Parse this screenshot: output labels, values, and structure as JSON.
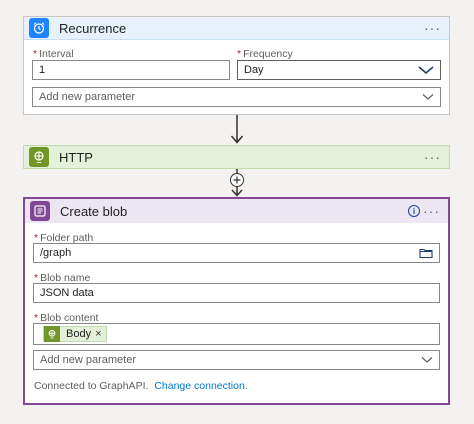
{
  "recurrence": {
    "title": "Recurrence",
    "more": "···",
    "interval_label": "Interval",
    "interval_value": "1",
    "frequency_label": "Frequency",
    "frequency_value": "Day",
    "add_param": "Add new parameter"
  },
  "http": {
    "title": "HTTP",
    "more": "···"
  },
  "create_blob": {
    "title": "Create blob",
    "more": "···",
    "folder_label": "Folder path",
    "folder_value": "/graph",
    "name_label": "Blob name",
    "name_value": "JSON data",
    "content_label": "Blob content",
    "token_label": "Body",
    "token_remove": "×",
    "add_param": "Add new parameter",
    "connected_text": "Connected to GraphAPI.",
    "change_connection": "Change connection."
  },
  "colors": {
    "recurrence_header": "#e6f1fc",
    "recurrence_icon": "#1f85ff",
    "http_header": "#e5f0d8",
    "http_icon": "#709727",
    "blob_header": "#ece6f2",
    "blob_border": "#804998",
    "blob_icon": "#804998",
    "link": "#0078d4"
  }
}
